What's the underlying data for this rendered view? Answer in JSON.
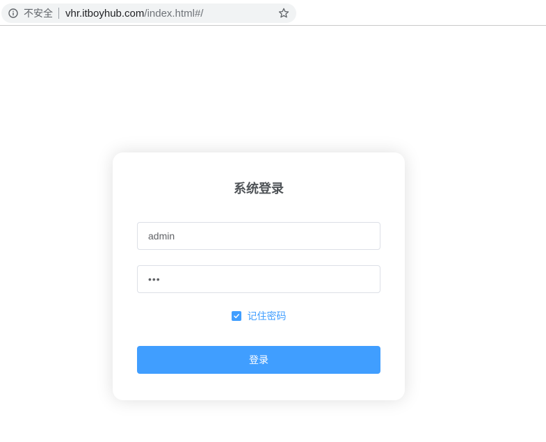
{
  "browser": {
    "security_label": "不安全",
    "url_host": "vhr.itboyhub.com",
    "url_path": "/index.html#/"
  },
  "login": {
    "title": "系统登录",
    "username_value": "admin",
    "password_masked": "•••",
    "remember_label": "记住密码",
    "remember_checked": true,
    "submit_label": "登录"
  },
  "colors": {
    "primary": "#409eff",
    "title_text": "#505458",
    "input_border": "#dcdfe6"
  },
  "icons": {
    "info": "info-icon",
    "bookmark": "star-icon",
    "check": "checkmark-icon"
  }
}
